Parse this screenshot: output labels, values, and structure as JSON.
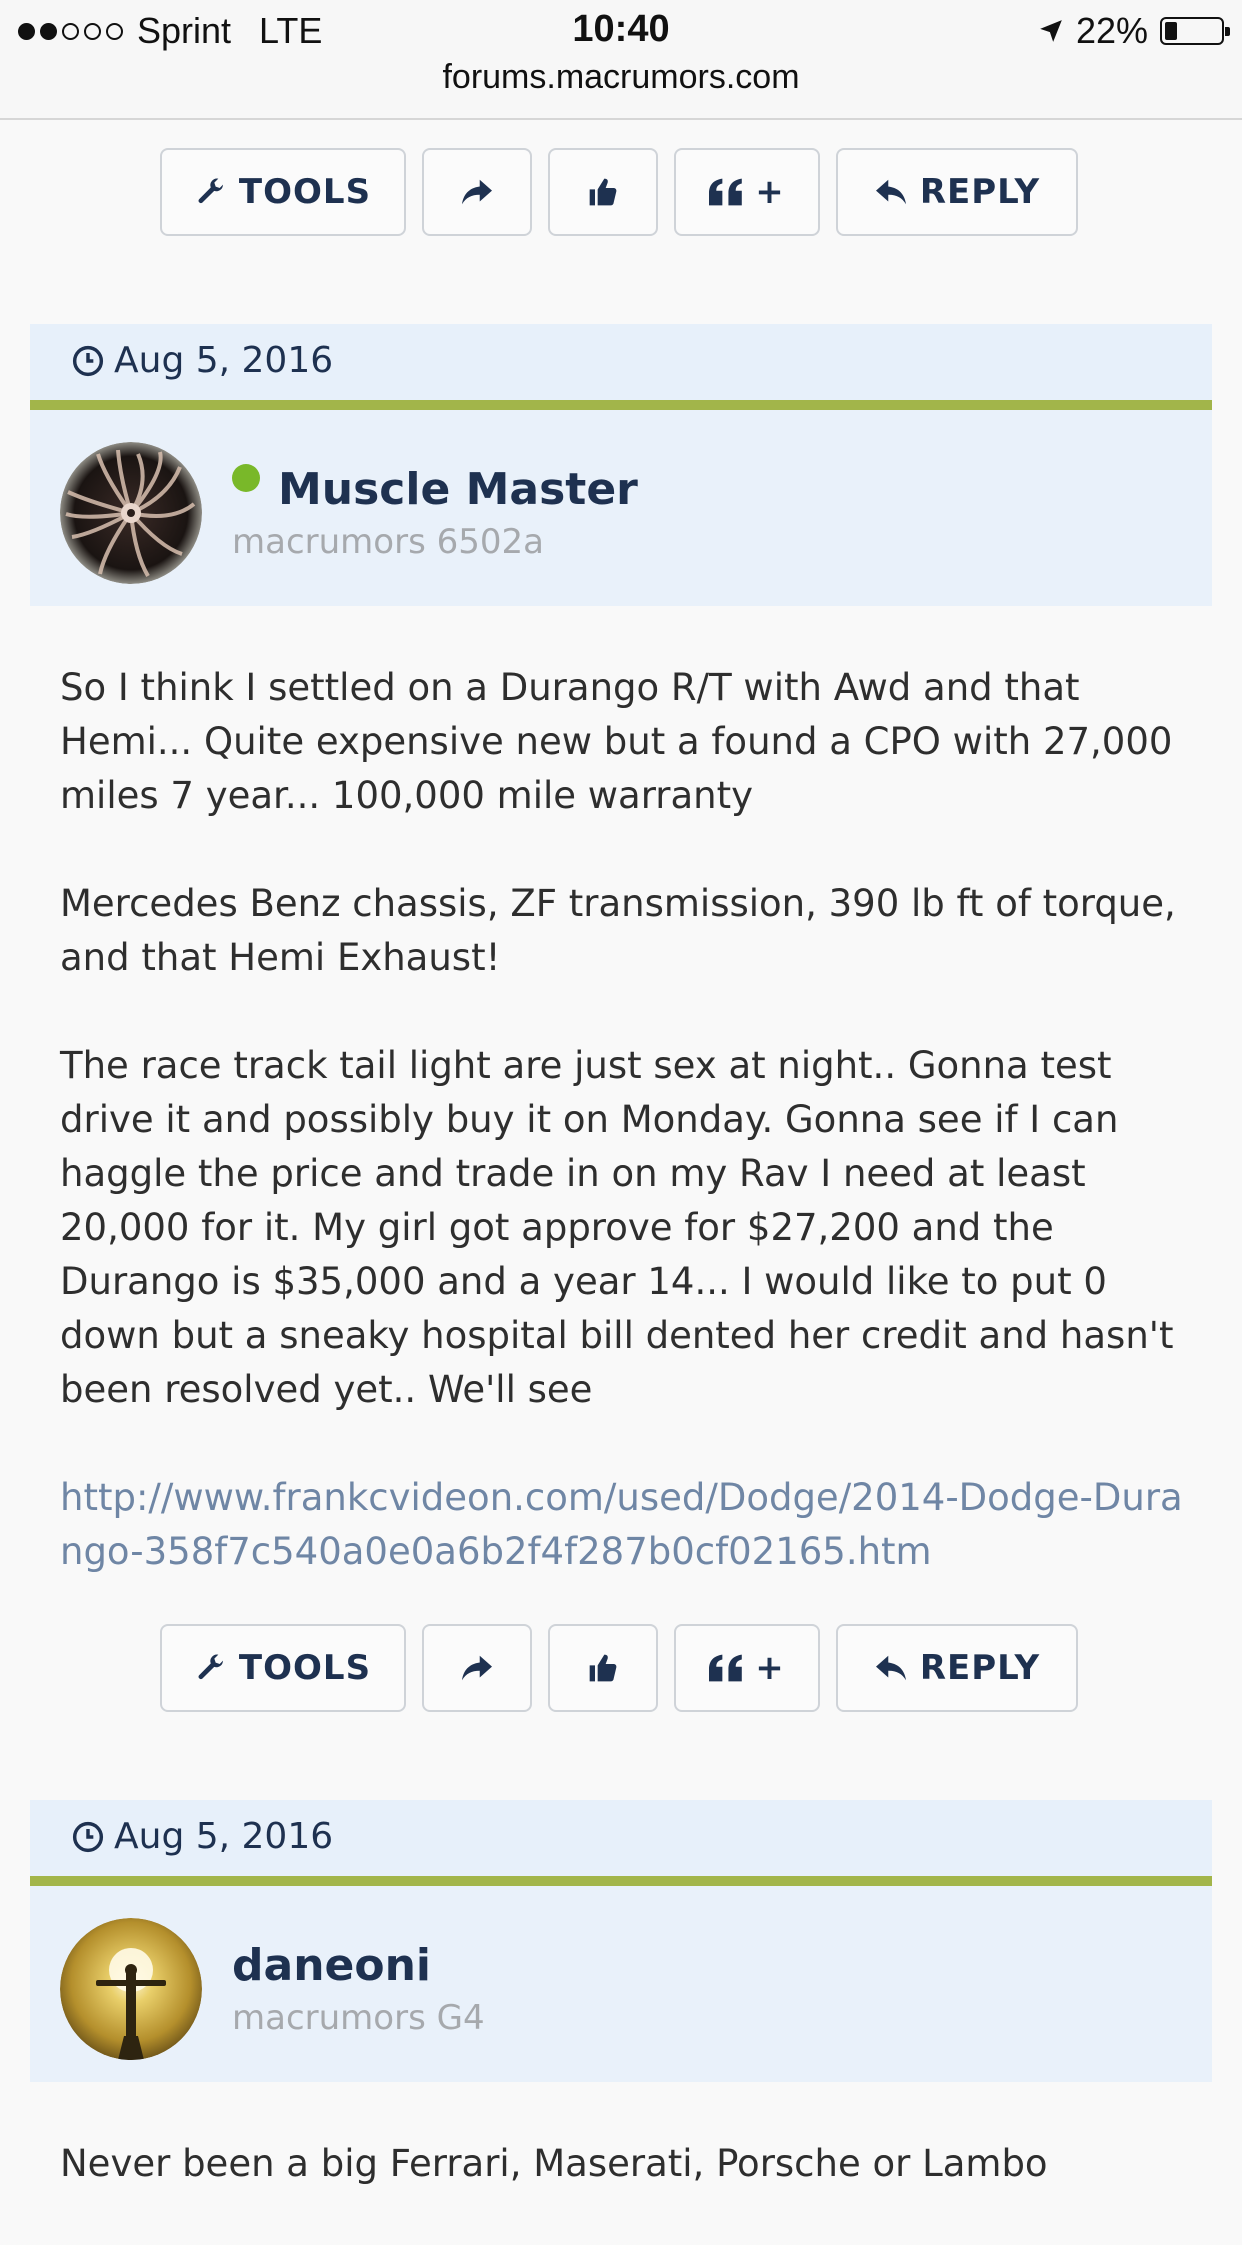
{
  "status": {
    "carrier": "Sprint",
    "network": "LTE",
    "time": "10:40",
    "battery": "22%",
    "battery_level": 0.22,
    "url": "forums.macrumors.com"
  },
  "toolbar": {
    "tools_label": "TOOLS",
    "quote_plus": "+",
    "reply_label": "REPLY"
  },
  "posts": [
    {
      "date": "Aug 5, 2016",
      "username": "Muscle Master",
      "user_title": "macrumors 6502a",
      "online": true,
      "paragraphs": [
        "So I think I settled on a Durango R/T with Awd and that Hemi... Quite expensive new but a found a CPO with 27,000 miles 7 year... 100,000 mile warranty",
        "Mercedes Benz chassis, ZF transmission, 390 lb ft of torque, and that Hemi Exhaust!",
        "The race track tail light are just sex at night.. Gonna test drive it and possibly buy it on Monday. Gonna see if I can haggle the price and trade in on my Rav I need at least 20,000 for it. My girl got approve for $27,200 and the Durango is $35,000 and a year 14... I would like to put 0 down but a sneaky hospital bill dented her credit and hasn't been resolved yet.. We'll see"
      ],
      "link": "http://www.frankcvideon.com/used/Dodge/2014-Dodge-Durango-358f7c540a0e0a6b2f4f287b0cf02165.htm"
    },
    {
      "date": "Aug 5, 2016",
      "username": "daneoni",
      "user_title": "macrumors G4",
      "online": false,
      "paragraphs": [
        "Never been a big Ferrari, Maserati, Porsche or Lambo"
      ]
    }
  ]
}
